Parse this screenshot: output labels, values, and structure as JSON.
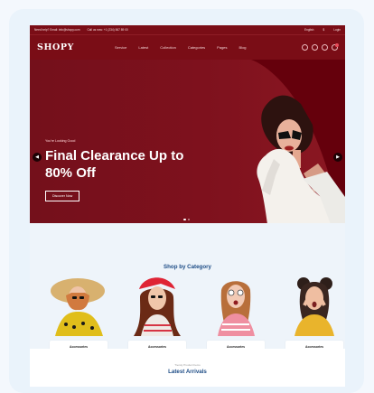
{
  "topbar": {
    "email": "Need help? Email: info@shopy.com",
    "phone": "Call us now: +1 (234) 567 89 00",
    "language": "English",
    "currency": "$",
    "login": "Login"
  },
  "navbar": {
    "logo": "SHOPY",
    "menu": [
      "Service",
      "Latest",
      "Collection",
      "Categories",
      "Pages",
      "Blog"
    ]
  },
  "hero": {
    "subtitle": "You're Looking Good",
    "title": "Final Clearance Up to 80% Off",
    "button": "Discover Now"
  },
  "categories": {
    "title": "Shop by Category",
    "items": [
      {
        "label": "Accessories",
        "count": "23 Products"
      },
      {
        "label": "Accessories",
        "count": "23 Products"
      },
      {
        "label": "Accessories",
        "count": "23 Products"
      },
      {
        "label": "Accessories",
        "count": "23 Products"
      }
    ]
  },
  "arrivals": {
    "kicker": "Trendy Product Items",
    "title": "Latest Arrivals"
  },
  "colors": {
    "brand": "#7a0d16",
    "accent": "#1c4b85"
  }
}
